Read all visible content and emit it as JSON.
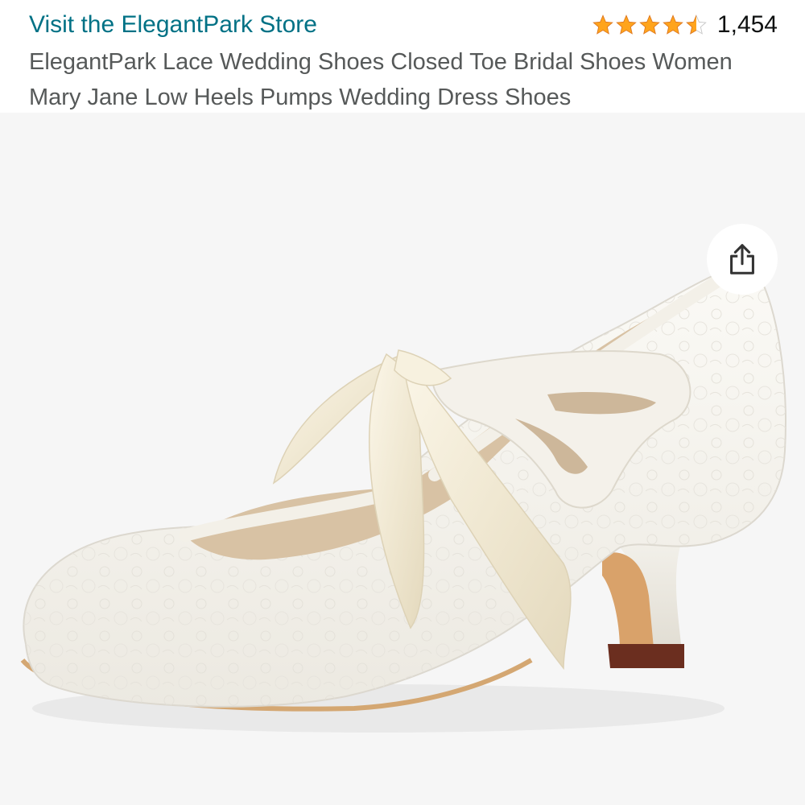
{
  "header": {
    "store_link": "Visit the ElegantPark Store",
    "rating": {
      "stars": 4.5,
      "count": "1,454",
      "star_color": "#FFA41C"
    },
    "title": "ElegantPark Lace Wedding Shoes Closed Toe Bridal Shoes Women Mary Jane Low Heels Pumps Wedding Dress Shoes"
  },
  "gallery": {
    "share_icon": "share-icon",
    "image_subject": "product-photo-shoe"
  },
  "colors": {
    "link": "#007185",
    "title": "#565959",
    "image_background": "#f6f6f6"
  }
}
